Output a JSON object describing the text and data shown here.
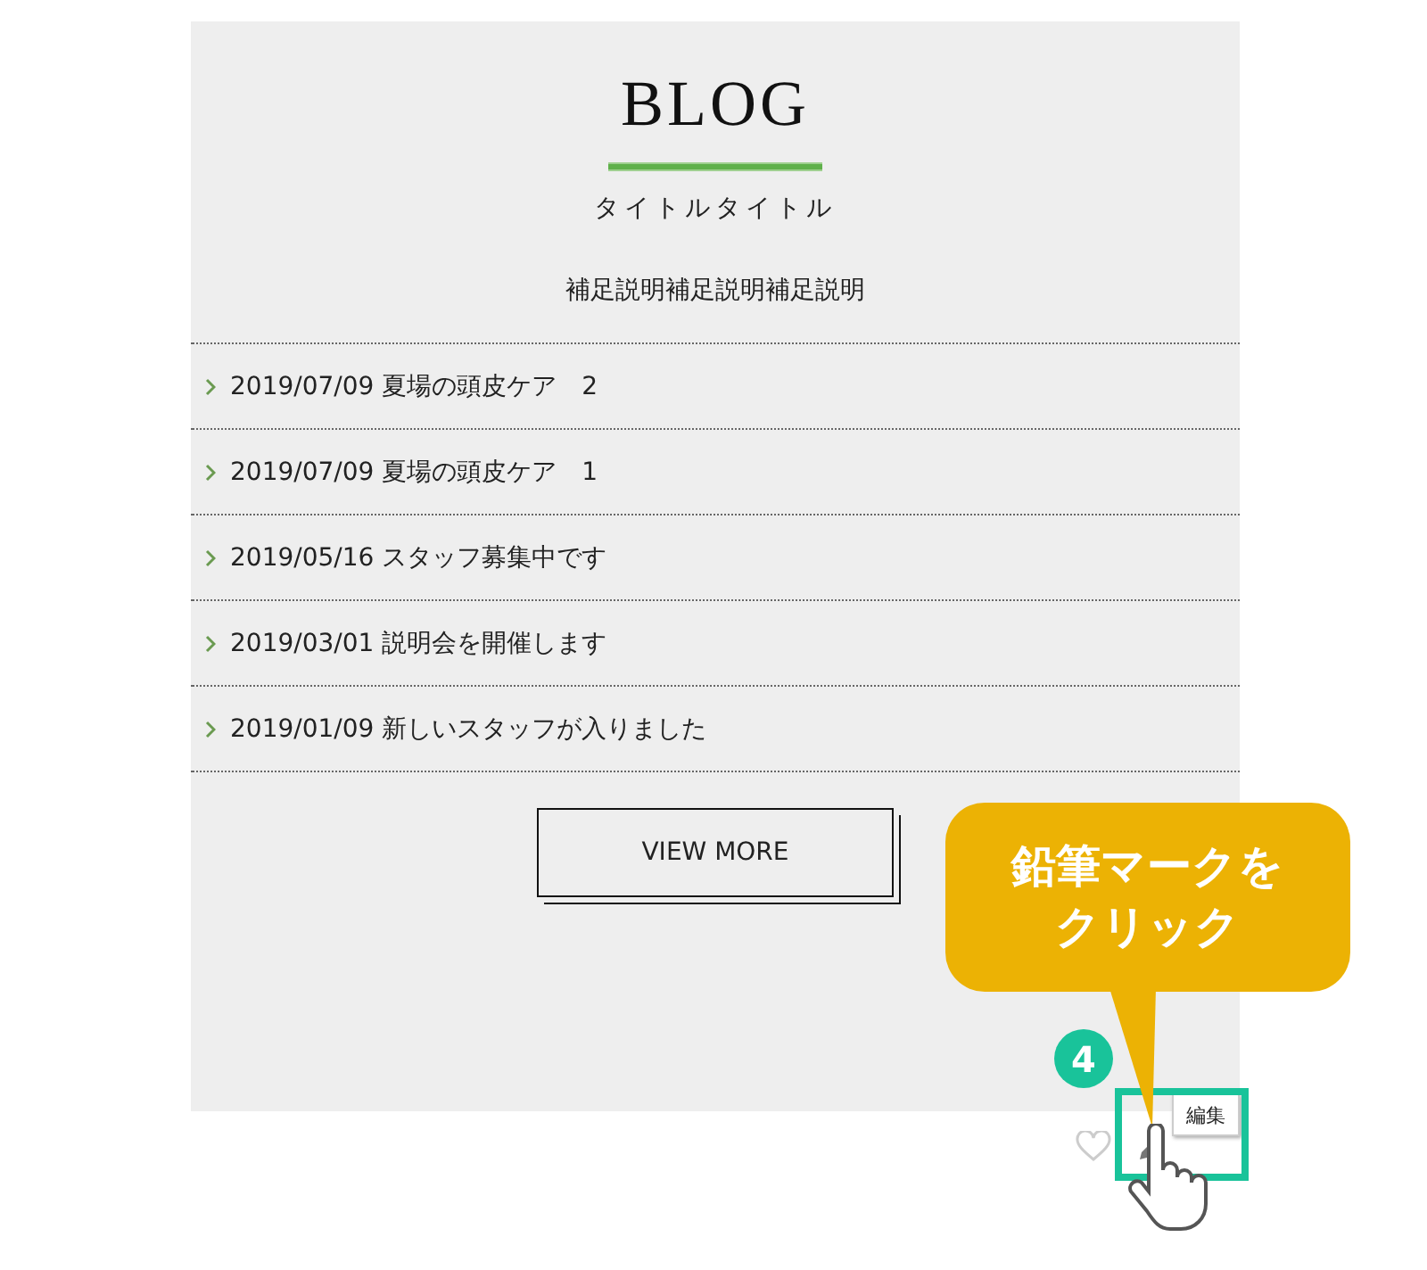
{
  "blog": {
    "heading": "BLOG",
    "subtitle": "タイトルタイトル",
    "description": "補足説明補足説明補足説明",
    "posts": [
      {
        "text": "2019/07/09 夏場の頭皮ケア　2"
      },
      {
        "text": "2019/07/09 夏場の頭皮ケア　1"
      },
      {
        "text": "2019/05/16 スタッフ募集中です"
      },
      {
        "text": "2019/03/01 説明会を開催します"
      },
      {
        "text": "2019/01/09 新しいスタッフが入りました"
      }
    ],
    "button": "VIEW MORE"
  },
  "tools": {
    "tooltip": "編集"
  },
  "annotation": {
    "step": "4",
    "callout": "鉛筆マークをクリック"
  }
}
